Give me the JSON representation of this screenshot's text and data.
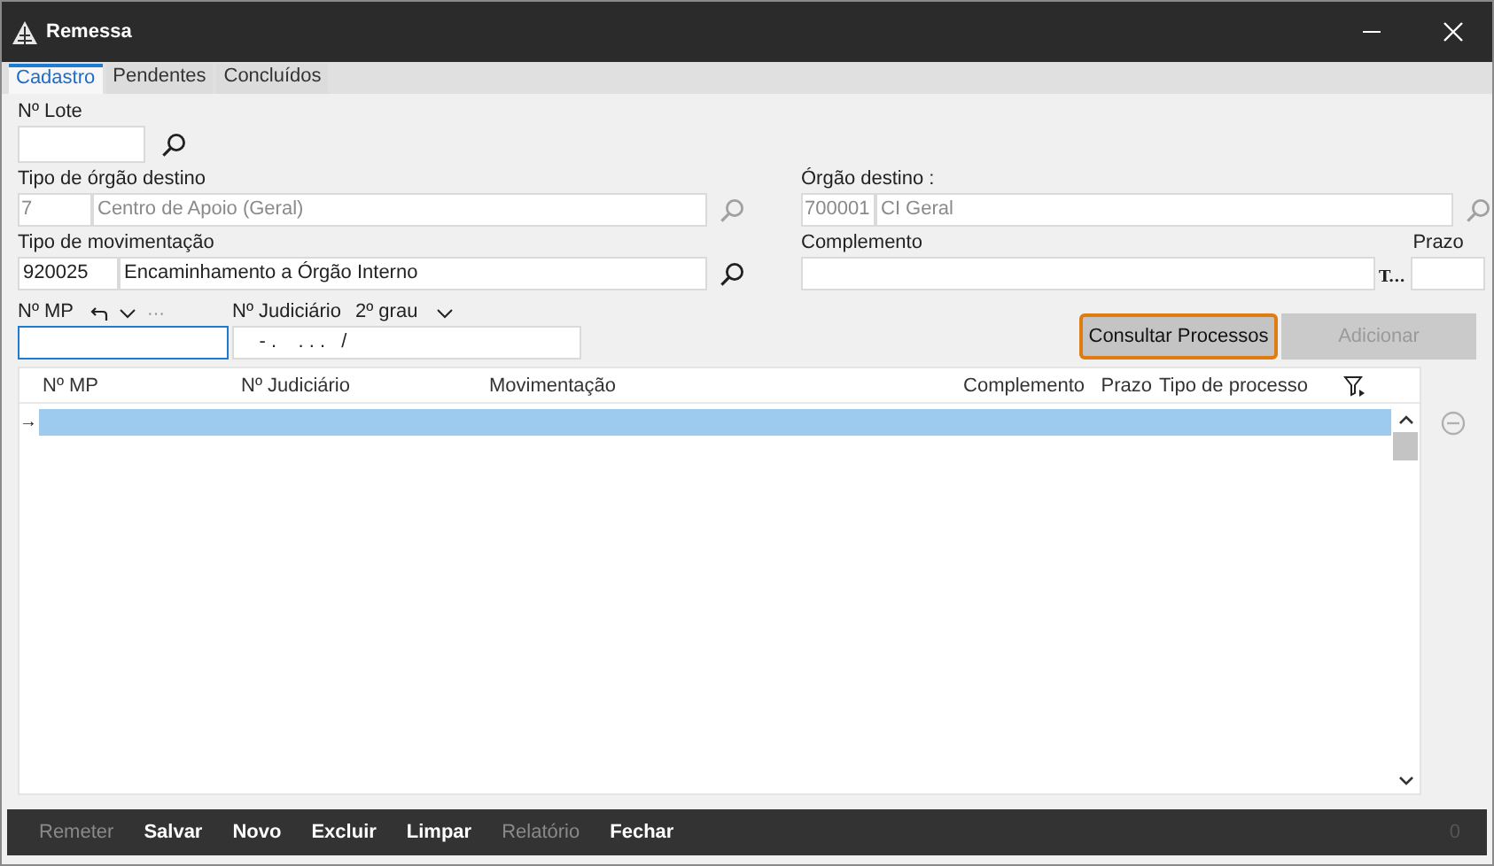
{
  "window": {
    "title": "Remessa"
  },
  "tabs": [
    {
      "label": "Cadastro",
      "selected": true
    },
    {
      "label": "Pendentes",
      "selected": false
    },
    {
      "label": "Concluídos",
      "selected": false
    }
  ],
  "form": {
    "lote_label": "Nº Lote",
    "tipo_orgao_label": "Tipo de órgão destino",
    "tipo_orgao_code": "7",
    "tipo_orgao_name": "Centro de Apoio (Geral)",
    "orgao_label": "Órgão destino :",
    "orgao_code": "700001",
    "orgao_name": "CI Geral",
    "tipo_mov_label": "Tipo de movimentação",
    "tipo_mov_code": "920025",
    "tipo_mov_name": "Encaminhamento a Órgão Interno",
    "complemento_label": "Complemento",
    "complemento_more": "T...",
    "prazo_label": "Prazo",
    "mp_label": "Nº MP",
    "more_dots": "···",
    "judiciario_label": "Nº Judiciário",
    "grau_label": "2º grau",
    "judiciario_mask": "    - .    . . .   /"
  },
  "actions": [
    {
      "label": "Consultar Processos",
      "disabled": false,
      "focused": true
    },
    {
      "label": "Adicionar",
      "disabled": true,
      "focused": false
    }
  ],
  "table": {
    "columns": [
      "Nº MP",
      "Nº Judiciário",
      "Movimentação",
      "Complemento",
      "Prazo",
      "Tipo de processo"
    ],
    "current_row_marker": "→"
  },
  "footer": {
    "buttons": [
      {
        "label": "Remeter",
        "disabled": true
      },
      {
        "label": "Salvar",
        "disabled": false
      },
      {
        "label": "Novo",
        "disabled": false
      },
      {
        "label": "Excluir",
        "disabled": false
      },
      {
        "label": "Limpar",
        "disabled": false
      },
      {
        "label": "Relatório",
        "disabled": true
      },
      {
        "label": "Fechar",
        "disabled": false
      }
    ],
    "counter": "0"
  }
}
